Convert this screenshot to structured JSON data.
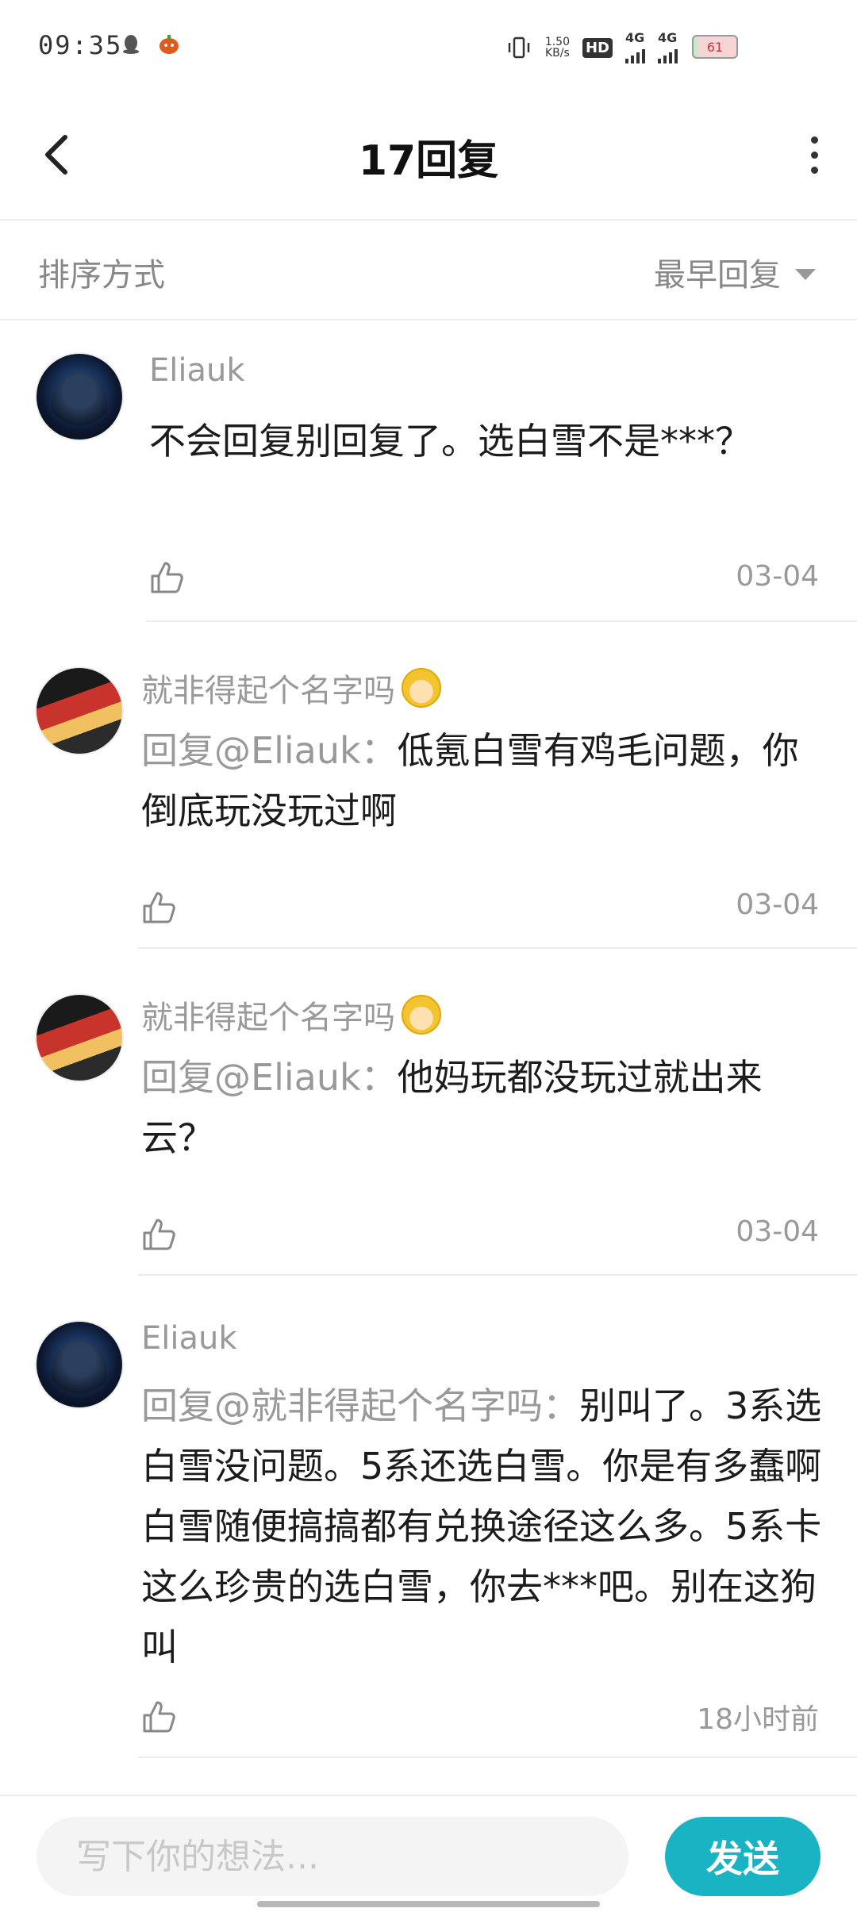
{
  "status_bar": {
    "time": "09:35",
    "net_speed": "1.50\nKB/s",
    "hd": "HD",
    "signal1": "4G",
    "signal2": "4G",
    "battery": "61"
  },
  "header": {
    "title": "17回复"
  },
  "sort": {
    "label": "排序方式",
    "value": "最早回复"
  },
  "replies": [
    {
      "username": "Eliauk",
      "mention": "",
      "text": "不会回复别回复了。选白雪不是***？",
      "date": "03-04"
    },
    {
      "username": "就非得起个名字吗",
      "mention": "回复@Eliauk：",
      "text": "低氪白雪有鸡毛问题，你倒底玩没玩过啊",
      "date": "03-04"
    },
    {
      "username": "就非得起个名字吗",
      "mention": "回复@Eliauk：",
      "text": "他妈玩都没玩过就出来云？",
      "date": "03-04"
    },
    {
      "username": "Eliauk",
      "mention": "回复@就非得起个名字吗：",
      "text": "别叫了。3系选白雪没问题。5系还选白雪。你是有多蠢啊 白雪随便搞搞都有兑换途径这么多。5系卡这么珍贵的选白雪，你去***吧。别在这狗叫",
      "date": "18小时前"
    }
  ],
  "composer": {
    "placeholder": "写下你的想法...",
    "send_label": "发送"
  },
  "colors": {
    "accent": "#1ab3c4",
    "muted": "#999999"
  }
}
